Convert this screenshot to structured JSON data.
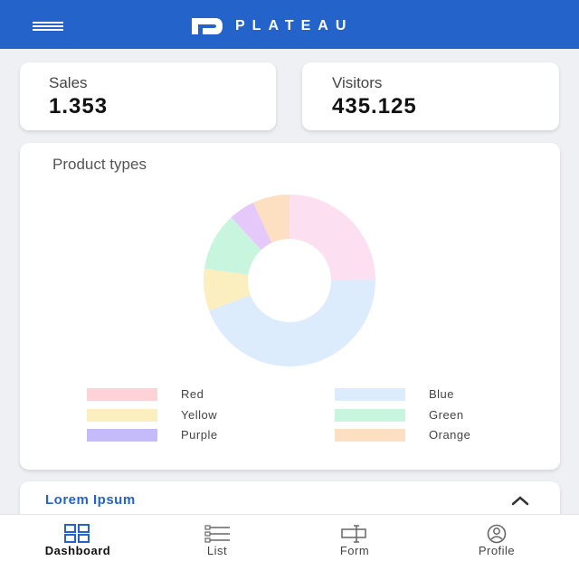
{
  "app": {
    "brand": "PLATEAU",
    "colors": {
      "primary": "#2463c9",
      "background": "#eef0f3",
      "card": "#ffffff"
    }
  },
  "stats": [
    {
      "label": "Sales",
      "value": "1.353"
    },
    {
      "label": "Visitors",
      "value": "435.125"
    }
  ],
  "chart_data": {
    "type": "pie",
    "title": "Product types",
    "donut": true,
    "legend_position": "bottom",
    "categories": [
      "Red",
      "Blue",
      "Yellow",
      "Green",
      "Purple",
      "Orange"
    ],
    "values": [
      25,
      45,
      8,
      11,
      5,
      7
    ],
    "colors": [
      "#fcdff0",
      "#ddecfc",
      "#fbefbf",
      "#c8f5de",
      "#e6c9fb",
      "#fde0c2"
    ],
    "legend_colors": [
      "#fdd3d8",
      "#ddecfc",
      "#fbefbf",
      "#c8f5de",
      "#c5bafa",
      "#fde0c2"
    ]
  },
  "accordion": {
    "title": "Lorem Ipsum",
    "state": "expanded",
    "icon": "chevron-up-icon"
  },
  "bottom_nav": [
    {
      "label": "Dashboard",
      "icon": "dashboard-icon",
      "active": true
    },
    {
      "label": "List",
      "icon": "list-icon",
      "active": false
    },
    {
      "label": "Form",
      "icon": "form-icon",
      "active": false
    },
    {
      "label": "Profile",
      "icon": "profile-icon",
      "active": false
    }
  ]
}
